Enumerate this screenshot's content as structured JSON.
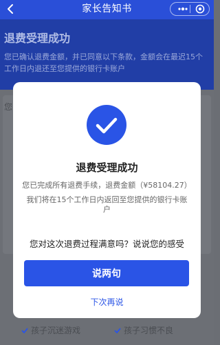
{
  "nav": {
    "title": "家长告知书"
  },
  "background": {
    "heading": "退费受理成功",
    "description": "您已确认退费金额，并已同意以下条款，金额会在最迟15个工作日内退还至您提供的银行卡账户",
    "partial_label": "您",
    "options": [
      "孩子沉迷游戏",
      "孩子习惯不良"
    ]
  },
  "modal": {
    "title": "退费受理成功",
    "line1": "您已完成所有退费手续，退费金额（¥58104.27）",
    "line2": "我们将在15个工作日内返回至您提供的银行卡账户",
    "question": "您对这次退费过程满意吗？说说您的感受",
    "primary_button": "说两句",
    "secondary_link": "下次再说"
  },
  "colors": {
    "accent": "#2a54e6",
    "nav_bg": "#2a4fd8"
  }
}
